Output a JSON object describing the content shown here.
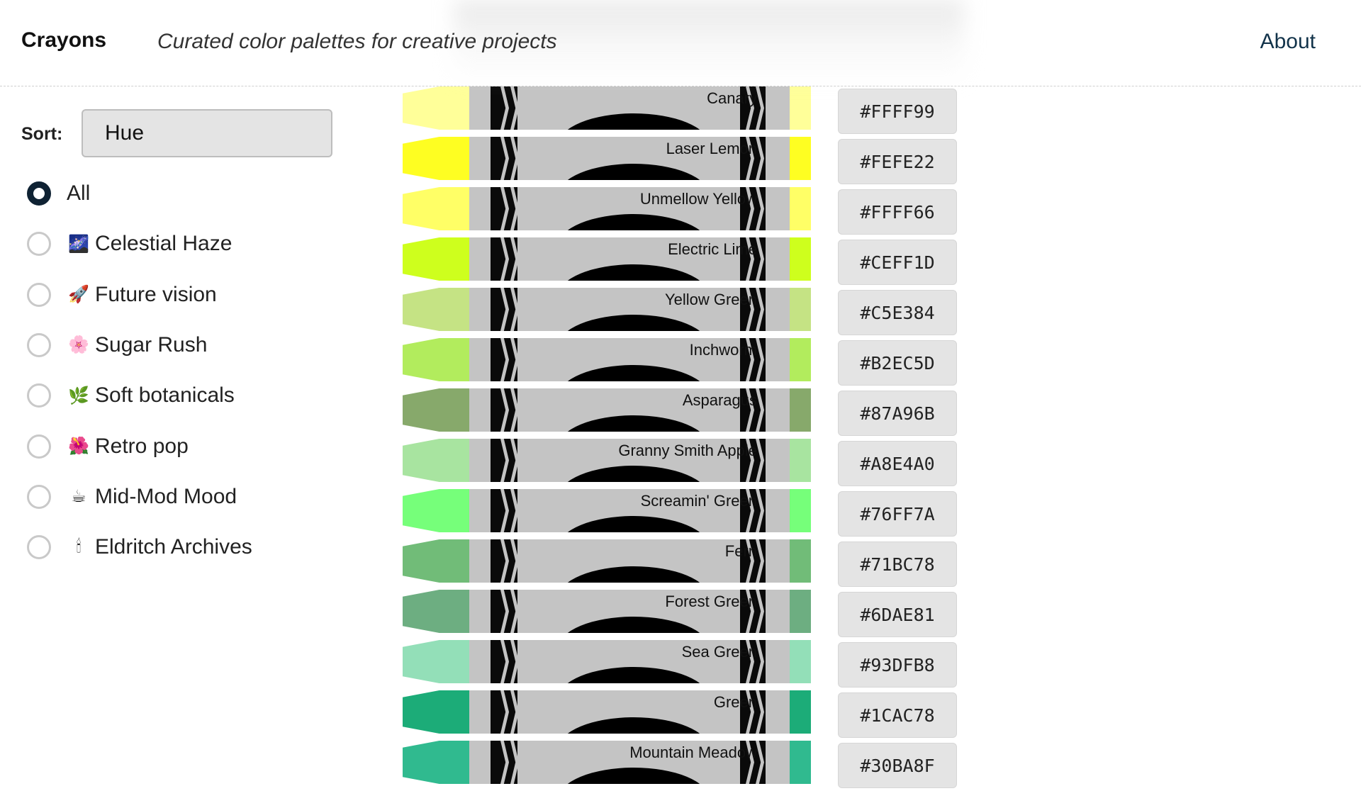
{
  "header": {
    "title": "Crayons",
    "tagline": "Curated color palettes for creative projects",
    "about_label": "About"
  },
  "sort": {
    "label": "Sort:",
    "selected": "Hue"
  },
  "filters": [
    {
      "label": "All",
      "icon": "",
      "checked": true
    },
    {
      "label": "Celestial Haze",
      "icon": "🌌",
      "checked": false
    },
    {
      "label": "Future vision",
      "icon": "🚀",
      "checked": false
    },
    {
      "label": "Sugar Rush",
      "icon": "🌸",
      "checked": false
    },
    {
      "label": "Soft botanicals",
      "icon": "🌿",
      "checked": false
    },
    {
      "label": "Retro pop",
      "icon": "🌺",
      "checked": false
    },
    {
      "label": "Mid-Mod Mood",
      "icon": "☕",
      "checked": false
    },
    {
      "label": "Eldritch Archives",
      "icon": "🕯",
      "checked": false
    }
  ],
  "crayons": [
    {
      "name": "Canary",
      "hex": "#FFFF99"
    },
    {
      "name": "Laser Lemon",
      "hex": "#FEFE22"
    },
    {
      "name": "Unmellow Yellow",
      "hex": "#FFFF66"
    },
    {
      "name": "Electric Lime",
      "hex": "#CEFF1D"
    },
    {
      "name": "Yellow Green",
      "hex": "#C5E384"
    },
    {
      "name": "Inchworm",
      "hex": "#B2EC5D"
    },
    {
      "name": "Asparagus",
      "hex": "#87A96B"
    },
    {
      "name": "Granny Smith Apple",
      "hex": "#A8E4A0"
    },
    {
      "name": "Screamin' Green",
      "hex": "#76FF7A"
    },
    {
      "name": "Fern",
      "hex": "#71BC78"
    },
    {
      "name": "Forest Green",
      "hex": "#6DAE81"
    },
    {
      "name": "Sea Green",
      "hex": "#93DFB8"
    },
    {
      "name": "Green",
      "hex": "#1CAC78"
    },
    {
      "name": "Mountain Meadow",
      "hex": "#30BA8F"
    }
  ],
  "colors": {
    "radio_checked": "#0f2233",
    "crayon_body": "#c4c4c4",
    "about_link": "#12334a"
  }
}
